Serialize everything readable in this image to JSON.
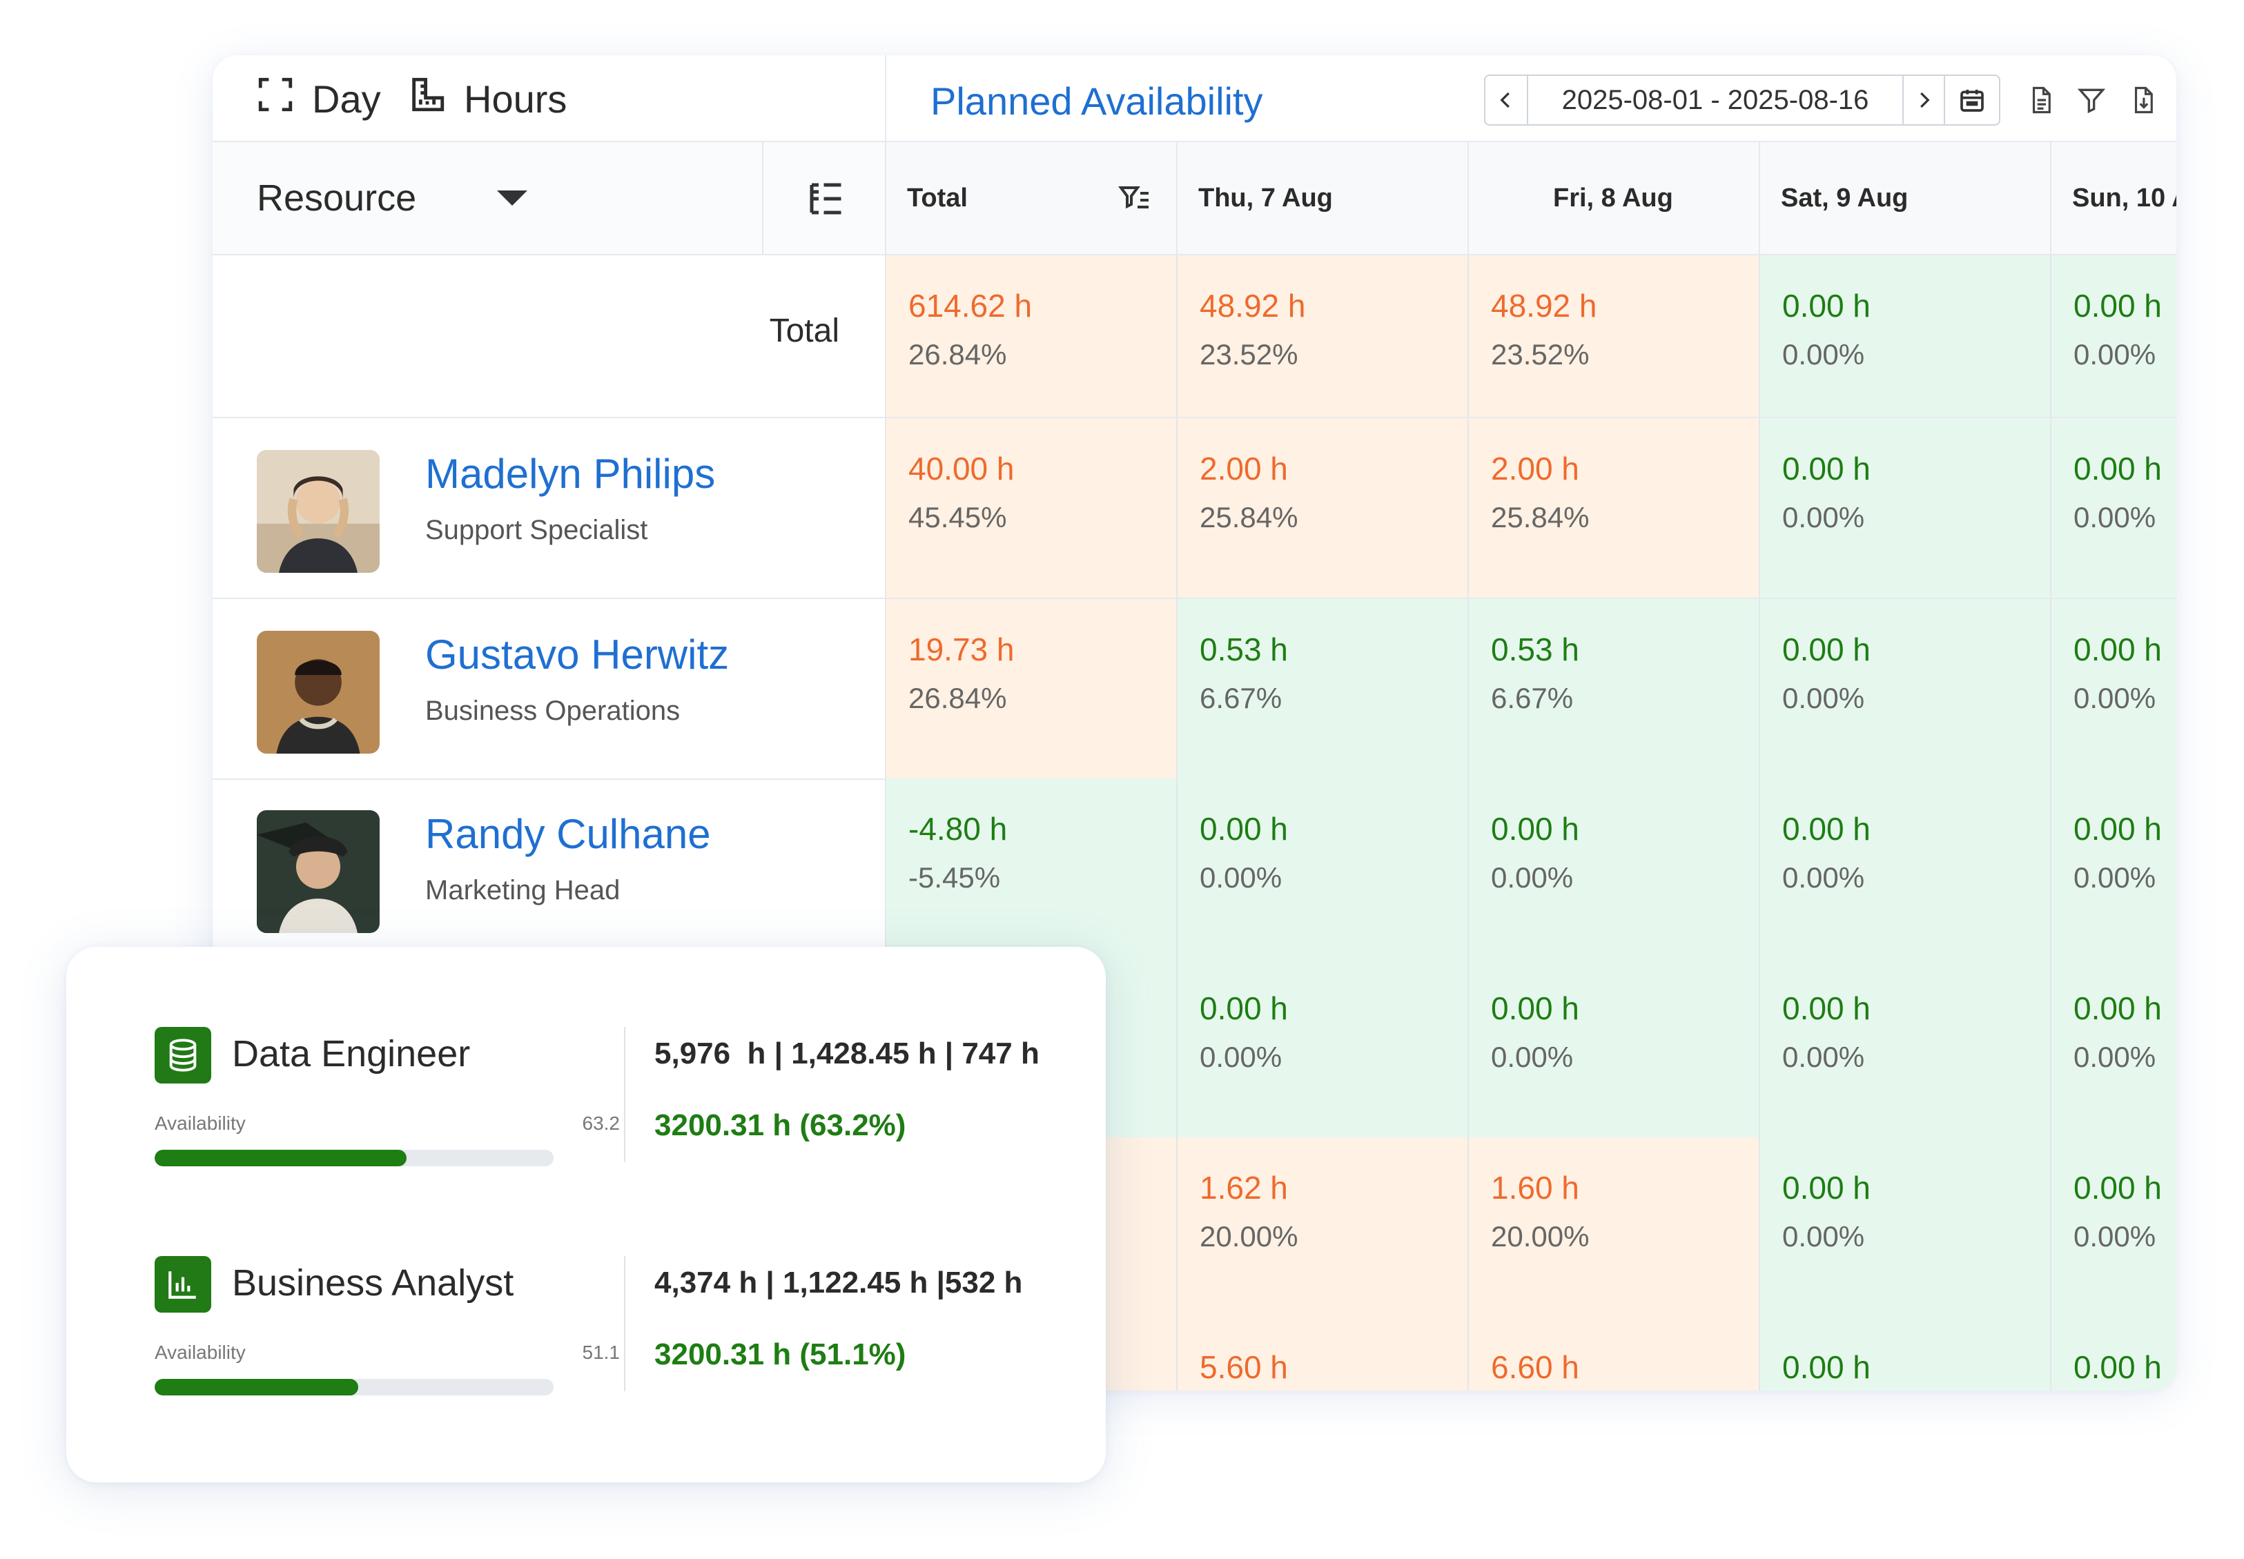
{
  "toolbar": {
    "day_label": "Day",
    "hours_label": "Hours",
    "title": "Planned Availability",
    "date_range": "2025-08-01 - 2025-08-16"
  },
  "resource_header": {
    "label": "Resource"
  },
  "columns": [
    {
      "label": "Total"
    },
    {
      "label": "Thu, 7 Aug"
    },
    {
      "label": "Fri, 8 Aug"
    },
    {
      "label": "Sat, 9 Aug"
    },
    {
      "label": "Sun, 10 A"
    }
  ],
  "total_row": {
    "label": "Total",
    "cells": [
      {
        "h": "614.62 h",
        "p": "26.84%",
        "status": "warn"
      },
      {
        "h": "48.92 h",
        "p": "23.52%",
        "status": "warn"
      },
      {
        "h": "48.92 h",
        "p": "23.52%",
        "status": "warn"
      },
      {
        "h": "0.00 h",
        "p": "0.00%",
        "status": "ok"
      },
      {
        "h": "0.00 h",
        "p": "0.00%",
        "status": "ok"
      }
    ]
  },
  "people": [
    {
      "name": "Madelyn Philips",
      "role": "Support Specialist",
      "cells": [
        {
          "h": "40.00 h",
          "p": "45.45%",
          "status": "warn"
        },
        {
          "h": "2.00 h",
          "p": "25.84%",
          "status": "warn"
        },
        {
          "h": "2.00 h",
          "p": "25.84%",
          "status": "warn"
        },
        {
          "h": "0.00 h",
          "p": "0.00%",
          "status": "ok"
        },
        {
          "h": "0.00 h",
          "p": "0.00%",
          "status": "ok"
        }
      ]
    },
    {
      "name": "Gustavo Herwitz",
      "role": "Business Operations",
      "cells": [
        {
          "h": "19.73 h",
          "p": "26.84%",
          "status": "warn"
        },
        {
          "h": "0.53 h",
          "p": "6.67%",
          "status": "ok"
        },
        {
          "h": "0.53 h",
          "p": "6.67%",
          "status": "ok"
        },
        {
          "h": "0.00 h",
          "p": "0.00%",
          "status": "ok"
        },
        {
          "h": "0.00 h",
          "p": "0.00%",
          "status": "ok"
        }
      ]
    },
    {
      "name": "Randy Culhane",
      "role": "Marketing Head",
      "cells": [
        {
          "h": "-4.80 h",
          "p": "-5.45%",
          "status": "ok"
        },
        {
          "h": "0.00 h",
          "p": "0.00%",
          "status": "ok"
        },
        {
          "h": "0.00 h",
          "p": "0.00%",
          "status": "ok"
        },
        {
          "h": "0.00 h",
          "p": "0.00%",
          "status": "ok"
        },
        {
          "h": "0.00 h",
          "p": "0.00%",
          "status": "ok"
        }
      ]
    },
    {
      "name": "",
      "role": "",
      "cells": [
        {
          "h": "",
          "p": "",
          "status": "ok"
        },
        {
          "h": "0.00 h",
          "p": "0.00%",
          "status": "ok"
        },
        {
          "h": "0.00 h",
          "p": "0.00%",
          "status": "ok"
        },
        {
          "h": "0.00 h",
          "p": "0.00%",
          "status": "ok"
        },
        {
          "h": "0.00 h",
          "p": "0.00%",
          "status": "ok"
        }
      ]
    },
    {
      "name": "",
      "role": "",
      "cells": [
        {
          "h": "",
          "p": "",
          "status": "warn"
        },
        {
          "h": "1.62 h",
          "p": "20.00%",
          "status": "warn"
        },
        {
          "h": "1.60 h",
          "p": "20.00%",
          "status": "warn"
        },
        {
          "h": "0.00 h",
          "p": "0.00%",
          "status": "ok"
        },
        {
          "h": "0.00 h",
          "p": "0.00%",
          "status": "ok"
        }
      ]
    },
    {
      "name": "",
      "role": "",
      "cells": [
        {
          "h": "",
          "p": "",
          "status": "warn"
        },
        {
          "h": "5.60 h",
          "p": "",
          "status": "warn"
        },
        {
          "h": "6.60 h",
          "p": "",
          "status": "warn"
        },
        {
          "h": "0.00 h",
          "p": "",
          "status": "ok"
        },
        {
          "h": "0.00 h",
          "p": "",
          "status": "ok"
        }
      ]
    }
  ],
  "summary": {
    "roles": [
      {
        "name": "Data Engineer",
        "icon": "database-icon",
        "availability_label": "Availability",
        "availability_value": "63.2",
        "availability_fraction": 0.632,
        "hours": "5,976  h | 1,428.45 h | 747 h",
        "available_hours": "3200.31 h (63.2%)"
      },
      {
        "name": "Business Analyst",
        "icon": "bar-chart-icon",
        "availability_label": "Availability",
        "availability_value": "51.1",
        "availability_fraction": 0.511,
        "hours": "4,374 h | 1,122.45 h |532 h",
        "available_hours": "3200.31 h (51.1%)"
      }
    ]
  },
  "colors": {
    "accent_blue": "#1f6fd1",
    "warn_text": "#ee6a2d",
    "warn_bg": "#fff1e3",
    "ok_text": "#1e7d13",
    "ok_bg": "#e6f8ee",
    "brand_green": "#217a15"
  }
}
